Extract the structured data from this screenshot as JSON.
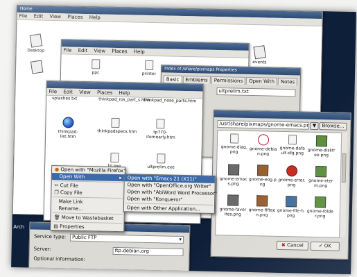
{
  "colors": {
    "screen_bg": "#0e1f3a",
    "titlebar": "#2d4a73",
    "menu_highlight": "#3b6aa8",
    "window_bg": "#dcdad5"
  },
  "desktop": {
    "window_title": "Home",
    "menu": [
      "File",
      "Edit",
      "View",
      "Places",
      "Help"
    ],
    "icons": {
      "desktop": "Desktop",
      "events": "events"
    }
  },
  "win2": {
    "menu": [
      "File",
      "Edit",
      "View",
      "Places",
      "Help"
    ],
    "icons": {
      "ppc": "ppc",
      "printer": "printer"
    }
  },
  "props": {
    "title": "Index of /share/pixmaps Properties",
    "tabs": [
      "Basic",
      "Emblems",
      "Permissions",
      "Open With",
      "Notes"
    ],
    "field": "ultprelim.txt"
  },
  "win3": {
    "menu": [
      "File",
      "Edit",
      "View",
      "Places",
      "Help"
    ],
    "top_files": [
      "splashes.txt",
      "thinkpad_ros_part_s.htm",
      "thinkpad_nose_parts.htm"
    ],
    "files": [
      {
        "name": "thinkpad-list.htm",
        "icon": "globe"
      },
      {
        "name": "thinkpadspecs.htm",
        "icon": "doc"
      },
      {
        "name": "tp770-itemearly.htm",
        "icon": "doc"
      },
      {
        "name": "tp.exe",
        "icon": "doc"
      },
      {
        "name": "ultprelim.exe",
        "icon": "doc"
      }
    ]
  },
  "context_menu": {
    "items": [
      "Open with \"Mozilla Firefox\"",
      "Open With",
      "Cut File",
      "Copy File",
      "Make Link",
      "Rename...",
      "Move to Wastebasket",
      "Properties"
    ]
  },
  "submenu": {
    "items": [
      "Open with \"Emacs 21 (X11)\"",
      "Open with \"OpenOffice.org Writer\"",
      "Open with \"AbiWord Word Processor\"",
      "Open with \"Konqueror\"",
      "Open with Other Application..."
    ]
  },
  "filechooser": {
    "path": "/usr/share/pixmaps/gnome-emacs.png",
    "browse": "Browse...",
    "icons": [
      {
        "label": "gnome-diag.png",
        "icon": "doc"
      },
      {
        "label": "gnome-debian.png",
        "icon": "swirl"
      },
      {
        "label": "gnome-default-dlg.png",
        "icon": "doc"
      },
      {
        "label": "gnome-diskfree.png",
        "icon": "sq"
      },
      {
        "label": "gnome-emacs.png",
        "icon": "sq"
      },
      {
        "label": "gnome-eog.png",
        "icon": "sq"
      },
      {
        "label": "gnome-error.png",
        "icon": "redglobe"
      },
      {
        "label": "gnome-eterm.png",
        "icon": "sq"
      },
      {
        "label": "gnome-favorites.png",
        "icon": "sq"
      },
      {
        "label": "gnome-fifteen.png",
        "icon": "sq"
      },
      {
        "label": "gnome-file-h.png",
        "icon": "sq"
      },
      {
        "label": "gnome-folder.png",
        "icon": "sq"
      }
    ],
    "cancel": "Cancel",
    "ok": "OK"
  },
  "connect": {
    "service_type_label": "Service type:",
    "service_type_value": "Public FTP",
    "server_label": "Server:",
    "server_value": "ftp.debian.org",
    "optional_label": "Optional information:",
    "side_label": "Arch"
  }
}
